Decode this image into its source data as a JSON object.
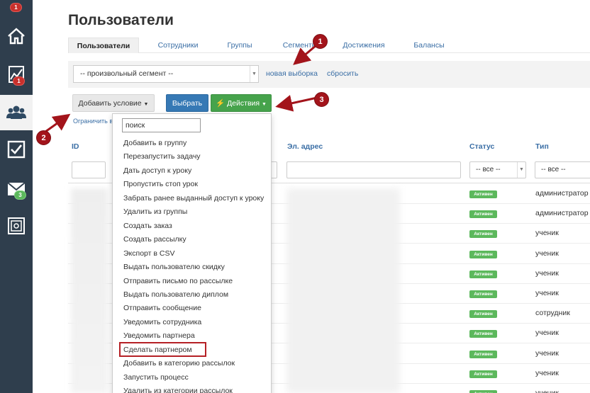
{
  "sidebar": {
    "items": [
      {
        "icon": "home-icon",
        "badge": "1"
      },
      {
        "icon": "stats-icon",
        "badge": "1"
      },
      {
        "icon": "users-icon",
        "active": true
      },
      {
        "icon": "tasks-icon"
      },
      {
        "icon": "mail-icon",
        "badge": "3"
      },
      {
        "icon": "safe-icon"
      }
    ],
    "top_badge": "1",
    "stats_badge": "1",
    "mail_badge": "3"
  },
  "page_title": "Пользователи",
  "tabs": [
    "Пользователи",
    "Сотрудники",
    "Группы",
    "Сегменты",
    "Достижения",
    "Балансы"
  ],
  "filter": {
    "segment_value": "-- произвольный сегмент --",
    "new_selection": "новая выборка",
    "reset": "сбросить"
  },
  "buttons": {
    "add_condition": "Добавить условие",
    "choose": "Выбрать",
    "actions": "Действия"
  },
  "limit_link": "Ограничить вы",
  "table": {
    "headers": {
      "id": "ID",
      "email": "Эл. адрес",
      "status": "Статус",
      "type": "Тип"
    },
    "status_filter": "-- все --",
    "type_filter": "-- все --",
    "rows": [
      {
        "status": "Активен",
        "type": "администратор"
      },
      {
        "status": "Активен",
        "type": "администратор"
      },
      {
        "status": "Активен",
        "type": "ученик"
      },
      {
        "status": "Активен",
        "type": "ученик"
      },
      {
        "status": "Активен",
        "type": "ученик"
      },
      {
        "status": "Активен",
        "type": "ученик"
      },
      {
        "status": "Активен",
        "type": "сотрудник"
      },
      {
        "status": "Активен",
        "type": "ученик"
      },
      {
        "status": "Активен",
        "type": "ученик"
      },
      {
        "status": "Активен",
        "type": "ученик"
      },
      {
        "status": "Активен",
        "type": "ученик"
      }
    ]
  },
  "dropdown": {
    "search_value": "поиск",
    "items": [
      "Добавить в группу",
      "Перезапустить задачу",
      "Дать доступ к уроку",
      "Пропустить стоп урок",
      "Забрать ранее выданный доступ к уроку",
      "Удалить из группы",
      "Создать заказ",
      "Создать рассылку",
      "Экспорт в CSV",
      "Выдать пользователю скидку",
      "Отправить письмо по рассылке",
      "Выдать пользователю диплом",
      "Отправить сообщение",
      "Уведомить сотрудника",
      "Уведомить партнера",
      "Сделать партнером",
      "Добавить в категорию рассылок",
      "Запустить процесс",
      "Удалить из категории рассылок"
    ],
    "highlighted": "Сделать партнером"
  },
  "annotations": [
    "1",
    "2",
    "3"
  ],
  "colors": {
    "sidebar": "#2f3e4d",
    "link": "#3a6ea5",
    "primary": "#3679b5",
    "success": "#46a34c",
    "annotation": "#a3141b"
  }
}
